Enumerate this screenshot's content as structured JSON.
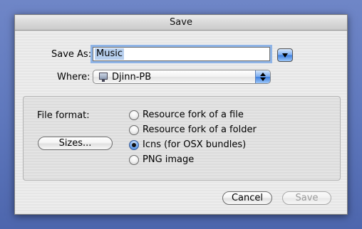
{
  "window": {
    "title": "Save"
  },
  "save_as": {
    "label": "Save As:",
    "value": "Music"
  },
  "where": {
    "label": "Where:",
    "selected": "Djinn-PB",
    "icon": "hard-drive-icon"
  },
  "options": {
    "file_format_label": "File format:",
    "sizes_button": "Sizes...",
    "radios": [
      {
        "label": "Resource fork of a file",
        "selected": false
      },
      {
        "label": "Resource fork of a folder",
        "selected": false
      },
      {
        "label": "Icns (for OSX bundles)",
        "selected": true
      },
      {
        "label": "PNG image",
        "selected": false
      }
    ]
  },
  "buttons": {
    "cancel": "Cancel",
    "save": "Save",
    "save_enabled": false
  },
  "colors": {
    "desktop": "#5f78bd",
    "accent": "#3d7fe0",
    "focus_ring": "#8fb4e6"
  }
}
